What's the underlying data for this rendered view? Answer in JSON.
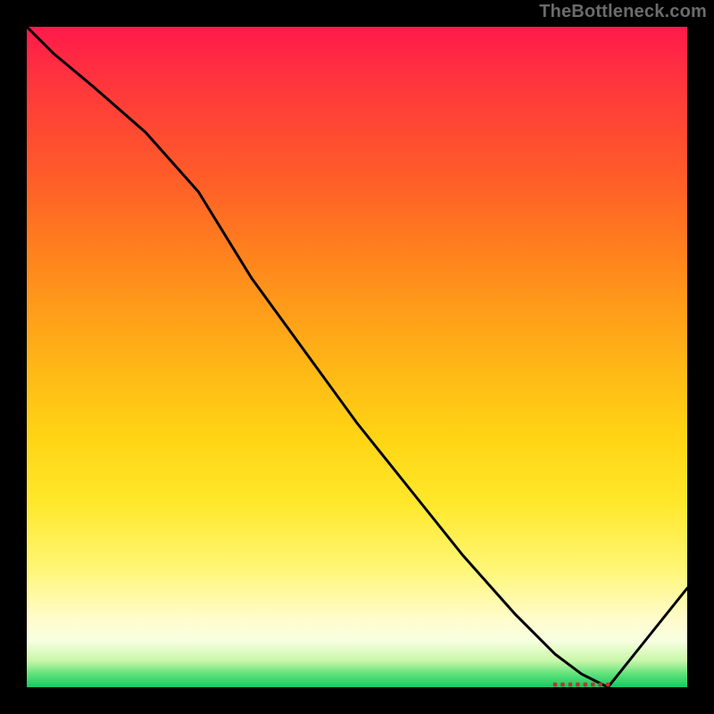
{
  "attribution": "TheBottleneck.com",
  "marker_label": "",
  "chart_data": {
    "type": "line",
    "title": "",
    "xlabel": "",
    "ylabel": "",
    "xlim": [
      0,
      100
    ],
    "ylim": [
      0,
      100
    ],
    "series": [
      {
        "name": "curve",
        "x": [
          0,
          4,
          10,
          18,
          26,
          34,
          42,
          50,
          58,
          66,
          74,
          80,
          84,
          86,
          88,
          92,
          96,
          100
        ],
        "y": [
          100,
          96,
          91,
          84,
          75,
          62,
          51,
          40,
          30,
          20,
          11,
          5,
          2,
          1,
          0,
          5,
          10,
          15
        ]
      }
    ],
    "marker": {
      "x_start": 80,
      "x_end": 88,
      "y": 0
    }
  },
  "colors": {
    "curve": "#000000",
    "marker": "#d02b2b",
    "background_top": "#ff1a4b",
    "background_bottom": "#18c862"
  }
}
